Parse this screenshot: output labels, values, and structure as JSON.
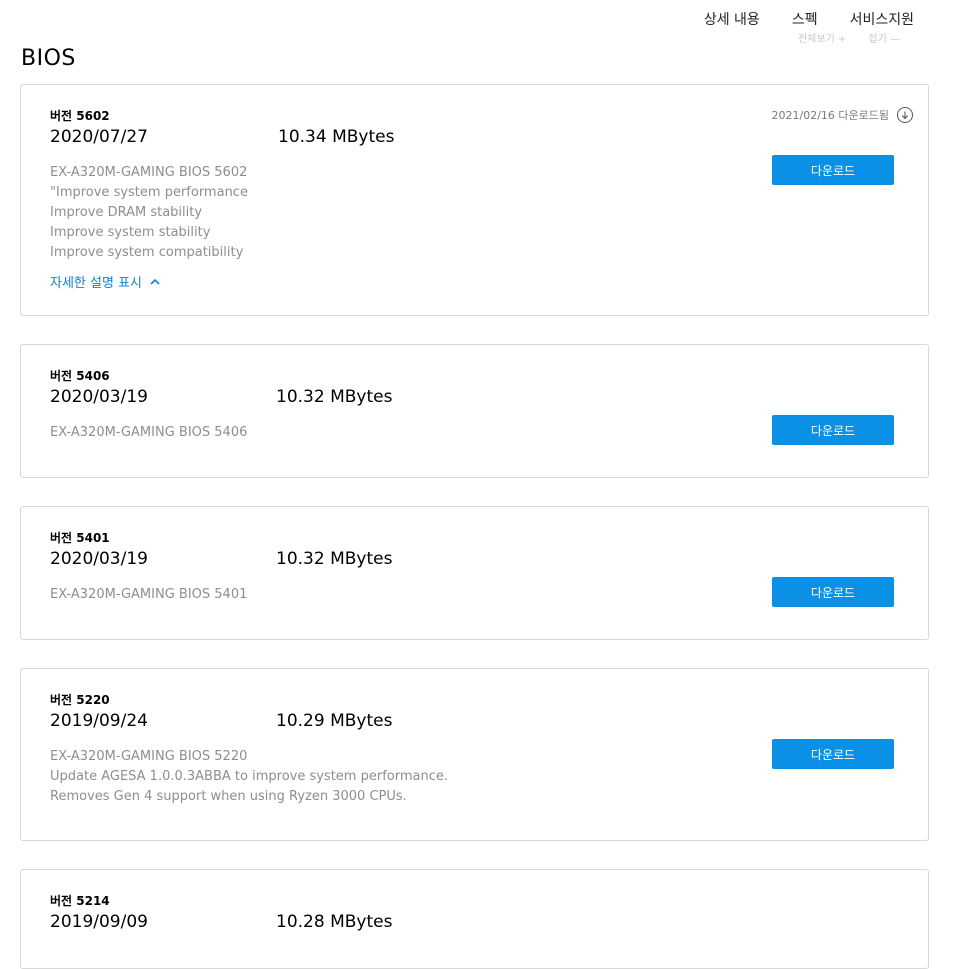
{
  "topnav": {
    "details": "상세 내용",
    "specs": "스펙",
    "support": "서비스지원"
  },
  "ghost": {
    "expand_all": "전체보기",
    "plus": "+",
    "collapse": "접기",
    "minus": "—"
  },
  "page_title": "BIOS",
  "download_label": "다운로드",
  "versions": [
    {
      "version": "버전 5602",
      "date": "2020/07/27",
      "size": "10.34 MBytes",
      "desc": [
        "EX-A320M-GAMING BIOS 5602",
        "\"Improve system performance",
        "Improve DRAM stability",
        "Improve system stability",
        "Improve system compatibility"
      ],
      "downloaded": "2021/02/16 다운로드됨",
      "details_toggle": "자세한 설명 표시"
    },
    {
      "version": "버전 5406",
      "date": "2020/03/19",
      "size": "10.32 MBytes",
      "desc": [
        "EX-A320M-GAMING BIOS 5406"
      ]
    },
    {
      "version": "버전 5401",
      "date": "2020/03/19",
      "size": "10.32 MBytes",
      "desc": [
        "EX-A320M-GAMING BIOS 5401"
      ]
    },
    {
      "version": "버전 5220",
      "date": "2019/09/24",
      "size": "10.29 MBytes",
      "desc": [
        "EX-A320M-GAMING BIOS 5220",
        "Update AGESA 1.0.0.3ABBA to improve system performance.",
        "Removes Gen 4 support when using Ryzen 3000 CPUs."
      ]
    },
    {
      "version": "버전 5214",
      "date": "2019/09/09",
      "size": "10.28 MBytes"
    }
  ],
  "colors": {
    "accent": "#0a91e6",
    "link": "#1380d4",
    "muted_text": "#8e8e8e",
    "border": "#d8d8d8"
  }
}
